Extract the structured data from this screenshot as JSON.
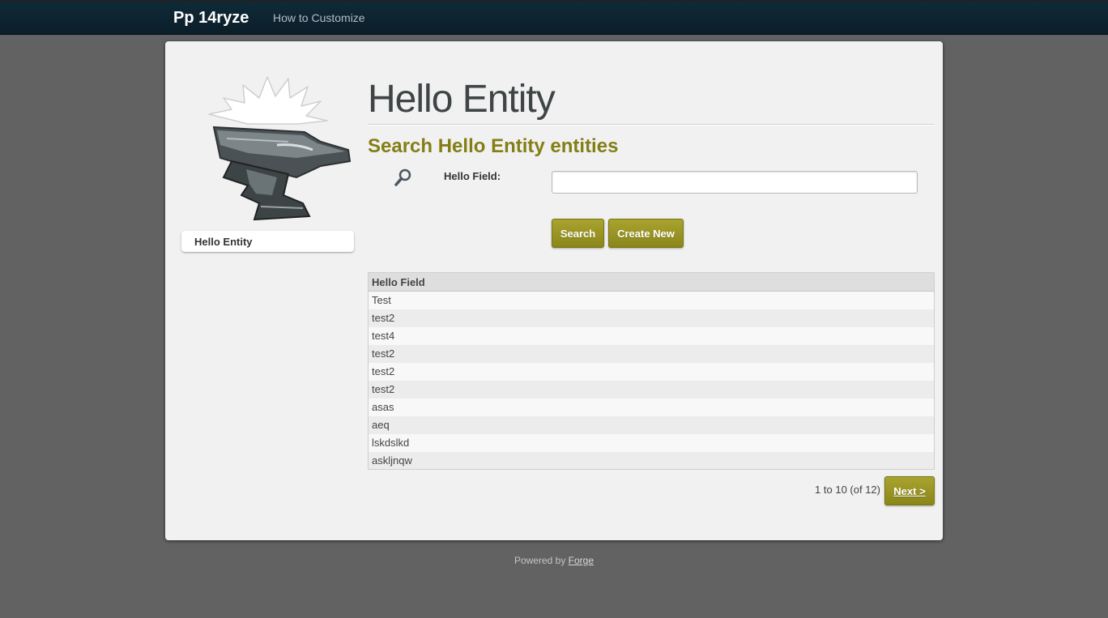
{
  "topbar": {
    "brand": "Pp 14ryze",
    "nav_link": "How to Customize"
  },
  "sidebar": {
    "items": [
      {
        "label": "Hello Entity"
      }
    ]
  },
  "main": {
    "title": "Hello Entity",
    "section_title": "Search Hello Entity entities",
    "search_form": {
      "field_label": "Hello Field:",
      "field_value": "",
      "search_button": "Search",
      "create_button": "Create New"
    },
    "table": {
      "columns": [
        "Hello Field"
      ],
      "rows": [
        "Test",
        "test2",
        "test4",
        "test2",
        "test2",
        "test2",
        "asas",
        "aeq",
        "lskdslkd",
        "askljnqw"
      ]
    },
    "pagination": {
      "info": "1 to 10 (of 12)",
      "next_label": "Next >"
    }
  },
  "footer": {
    "prefix": "Powered by",
    "link": "Forge"
  },
  "colors": {
    "accent": "#8b861a",
    "heading": "#837e16",
    "topbar": "#0f2a38",
    "background": "#626262"
  },
  "icons": [
    "anvil-logo",
    "magnifier-icon"
  ]
}
